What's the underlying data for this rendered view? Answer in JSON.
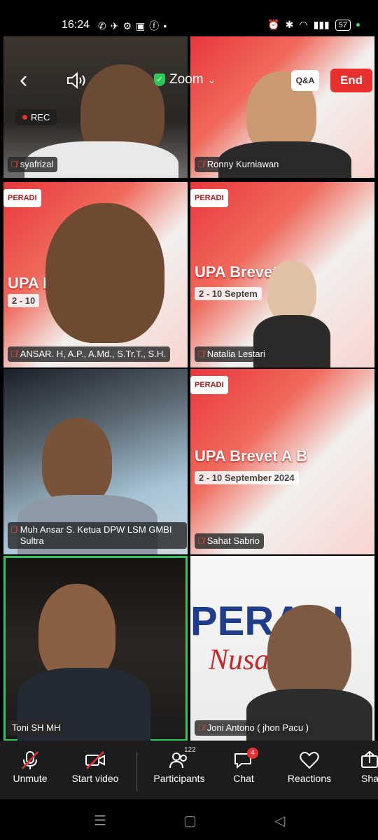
{
  "status_bar": {
    "time": "16:24",
    "battery": "57"
  },
  "top_controls": {
    "app_title": "Zoom",
    "qa_label": "Q&A",
    "end_label": "End",
    "rec_label": "REC"
  },
  "participants": [
    {
      "name": "syafrizal",
      "muted": true
    },
    {
      "name": "Ronny Kurniawan",
      "muted": true
    },
    {
      "name": "ANSAR. H, A.P., A.Md., S.Tr.T., S.H.",
      "muted": true
    },
    {
      "name": "Natalia Lestari",
      "muted": true
    },
    {
      "name": "Muh Ansar S. Ketua DPW LSM GMBI Sultra",
      "muted": true
    },
    {
      "name": "Sahat Sabrio",
      "muted": true
    },
    {
      "name": "Toni SH MH",
      "muted": false
    },
    {
      "name": "Joni Antono ( jhon Pacu )",
      "muted": true
    }
  ],
  "banner": {
    "logo_1": "PERADI",
    "logo_2": "PERADI",
    "text_1": "UPA B",
    "text_2": "UPA Brevet A B",
    "text_3": "UPA Brevet A B",
    "date_1": "2 - 10",
    "date_2": "2 - 10 Septem",
    "date_3": "2 - 10 September 2024",
    "peradi_large": "PERADI",
    "nusantara": "Nusantara"
  },
  "toolbar": {
    "unmute": "Unmute",
    "start_video": "Start video",
    "participants": "Participants",
    "participants_count": "122",
    "chat": "Chat",
    "chat_badge": "4",
    "reactions": "Reactions",
    "share": "Sha"
  },
  "colors": {
    "end": "#e8312f",
    "active_speaker": "#2fc65a",
    "toolbar_bg": "#1c1c1e"
  }
}
